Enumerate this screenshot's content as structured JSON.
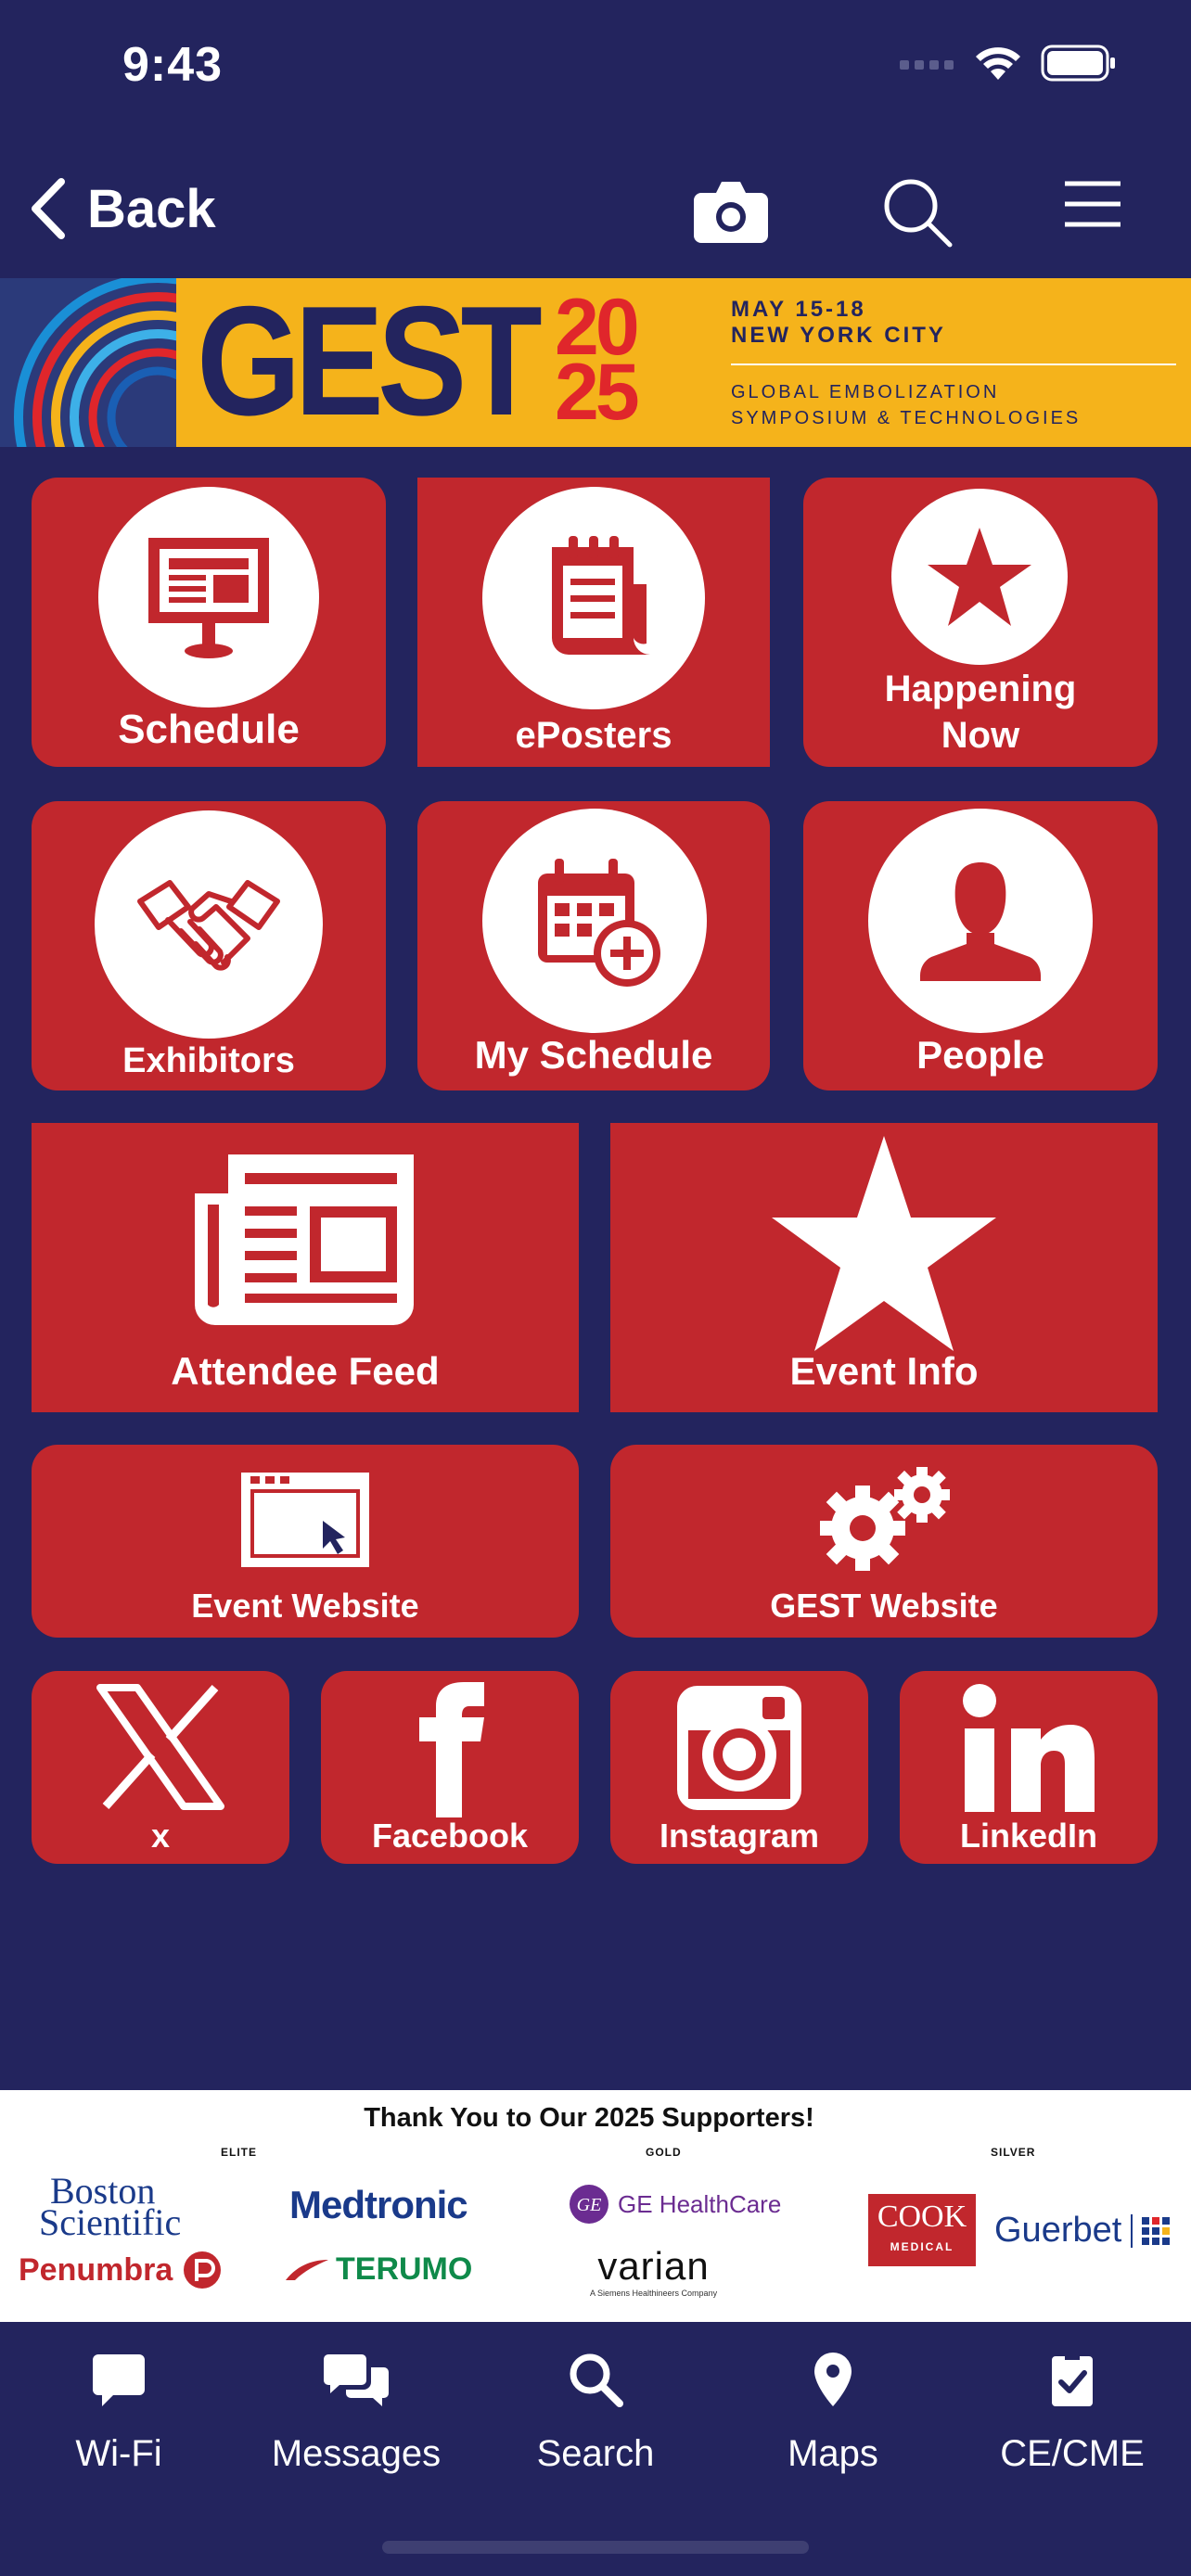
{
  "status": {
    "time": "9:43"
  },
  "nav": {
    "back_label": "Back"
  },
  "banner": {
    "gest": "GEST",
    "year_top": "20",
    "year_bottom": "25",
    "date": "MAY 15-18",
    "city": "NEW YORK CITY",
    "line1": "GLOBAL EMBOLIZATION",
    "line2": "SYMPOSIUM & TECHNOLOGIES",
    "colors": {
      "background": "#f5b31b",
      "navy": "#23245e",
      "red": "#e0262b"
    }
  },
  "tiles": {
    "schedule": "Schedule",
    "eposters": "ePosters",
    "happening_now_1": "Happening",
    "happening_now_2": "Now",
    "exhibitors": "Exhibitors",
    "my_schedule": "My Schedule",
    "people": "People",
    "attendee_feed": "Attendee Feed",
    "event_info": "Event Info",
    "event_website": "Event Website",
    "gest_website": "GEST Website",
    "x": "x",
    "facebook": "Facebook",
    "instagram": "Instagram",
    "linkedin": "LinkedIn"
  },
  "sponsors": {
    "title": "Thank You to Our 2025 Supporters!",
    "tiers": {
      "elite": "ELITE",
      "gold": "GOLD",
      "silver": "SILVER"
    },
    "logos": {
      "boston_1": "Boston",
      "boston_2": "Scientific",
      "penumbra": "Penumbra",
      "medtronic": "Medtronic",
      "terumo": "TERUMO",
      "ge": "GE HealthCare",
      "varian": "varian",
      "varian_sub": "A Siemens Healthineers Company",
      "cook": "COOK",
      "cook_sub": "MEDICAL",
      "guerbet": "Guerbet"
    }
  },
  "tabs": [
    {
      "label": "Wi-Fi",
      "icon": "chat-bubble-icon"
    },
    {
      "label": "Messages",
      "icon": "messages-icon"
    },
    {
      "label": "Search",
      "icon": "search-icon"
    },
    {
      "label": "Maps",
      "icon": "map-pin-icon"
    },
    {
      "label": "CE/CME",
      "icon": "clipboard-check-icon"
    }
  ],
  "theme": {
    "background": "#23245e",
    "tile": "#c1272d"
  }
}
